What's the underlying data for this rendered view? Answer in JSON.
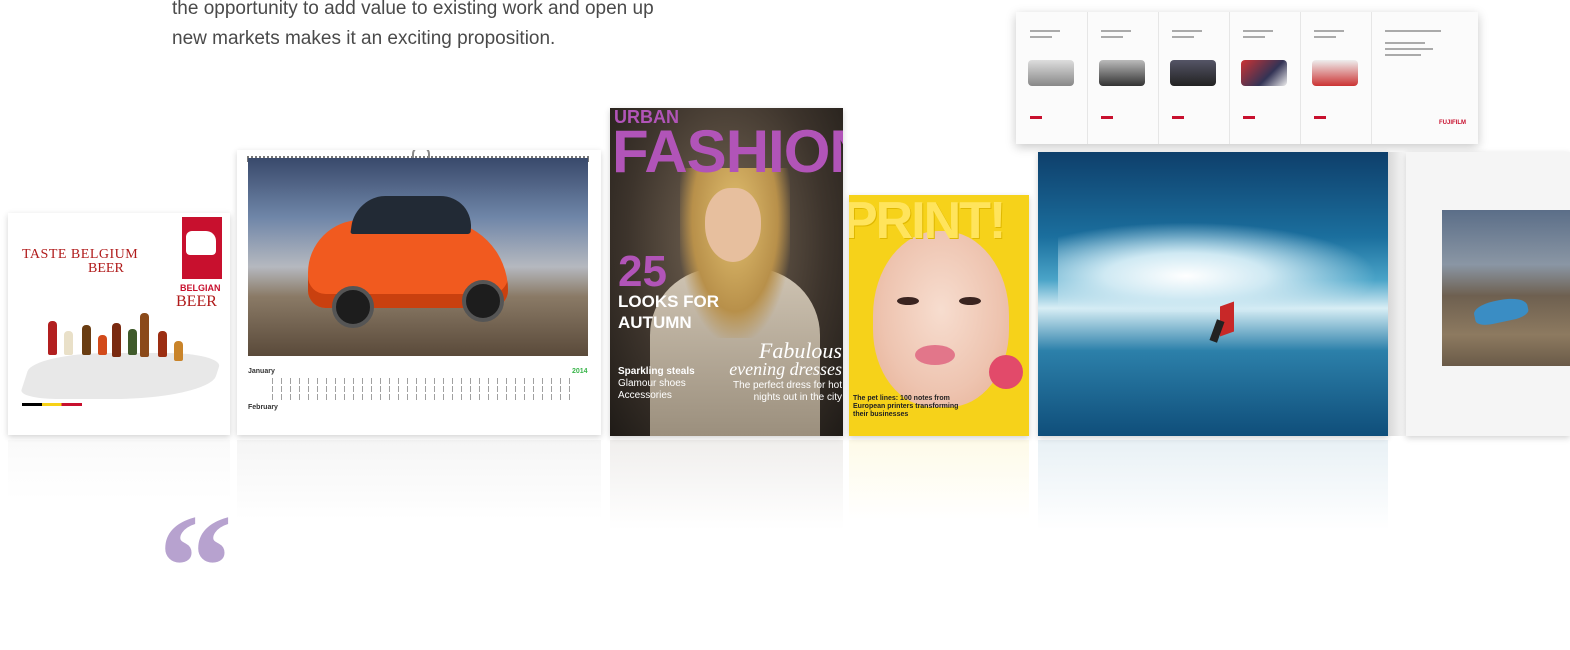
{
  "intro": {
    "line1": "the opportunity to add value to existing work and open up",
    "line2": "new markets makes it an exciting proposition."
  },
  "gallery": {
    "beer": {
      "title_line1": "TASTE BELGIUM",
      "title_line2": "BEER",
      "badge_label": "BELGIAN",
      "badge_word": "BEER"
    },
    "calendar": {
      "month1": "January",
      "month2": "February",
      "year": "2014"
    },
    "fashion": {
      "masthead_small": "URBAN",
      "masthead": "FASHION",
      "number": "25",
      "headline_line1": "LOOKS FOR",
      "headline_line2": "AUTUMN",
      "feature_line1": "Fabulous",
      "feature_line2": "evening dresses",
      "feature_sub": "The perfect dress for hot nights out in the city",
      "side_title": "Sparkling steals",
      "side_line1": "Glamour shoes",
      "side_line2": "Accessories"
    },
    "print": {
      "title": "PRINT!",
      "cover_text": "The pet lines: 100 notes from European printers transforming their businesses"
    },
    "brochure": {
      "brand": "FUJIFILM"
    }
  },
  "quote": {
    "mark": "“"
  },
  "colors": {
    "accent_purple": "#b154b8",
    "quote_lavender": "#b7a2cf",
    "body_text": "#4a4a4a"
  }
}
